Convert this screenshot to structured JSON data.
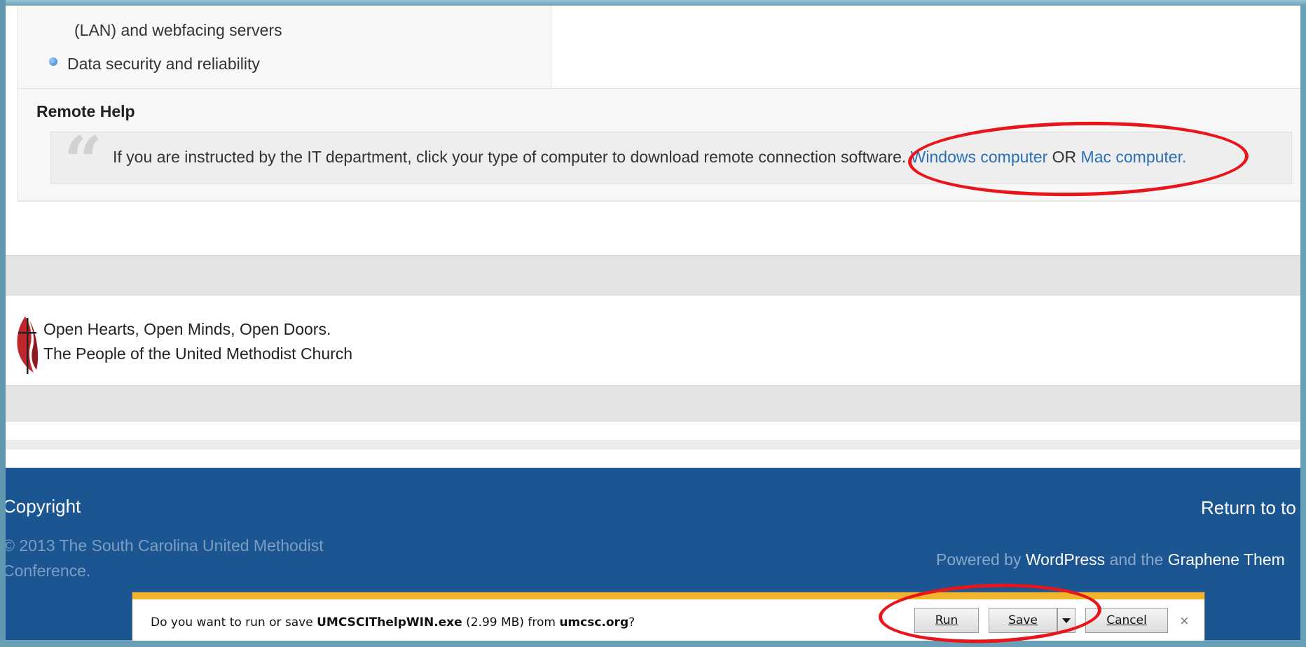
{
  "features": {
    "lan_line": "(LAN) and webfacing servers",
    "bullet_item": "Data security and reliability"
  },
  "remote_help": {
    "title": "Remote Help",
    "instruction": "If you are instructed by the IT department, click your type of computer to download remote connection software.",
    "windows_link": "Windows computer",
    "or_text": "OR",
    "mac_link": "Mac computer."
  },
  "tagline": {
    "line1": "Open Hearts, Open Minds, Open Doors.",
    "line2": "The People of the United Methodist Church"
  },
  "footer": {
    "copyright_heading": "Copyright",
    "notice_line1": "© 2013 The South Carolina United Methodist",
    "notice_line2": "Conference.",
    "return_to_top": "Return to to",
    "powered_by": "Powered by",
    "wordpress": "WordPress",
    "and_the": "and the",
    "theme": "Graphene Them"
  },
  "download_bar": {
    "prompt_prefix": "Do you want to run or save",
    "file_name": "UMCSCIThelpWIN.exe",
    "file_size": "(2.99 MB) from",
    "domain": "umcsc.org",
    "prompt_suffix": "?",
    "run_label": "Run",
    "save_label": "Save",
    "cancel_label": "Cancel",
    "close_symbol": "×"
  },
  "colors": {
    "footer_bg": "#1b5592",
    "link": "#2a6fb7",
    "annotation": "#e8151b",
    "download_accent": "#f1b42d"
  }
}
